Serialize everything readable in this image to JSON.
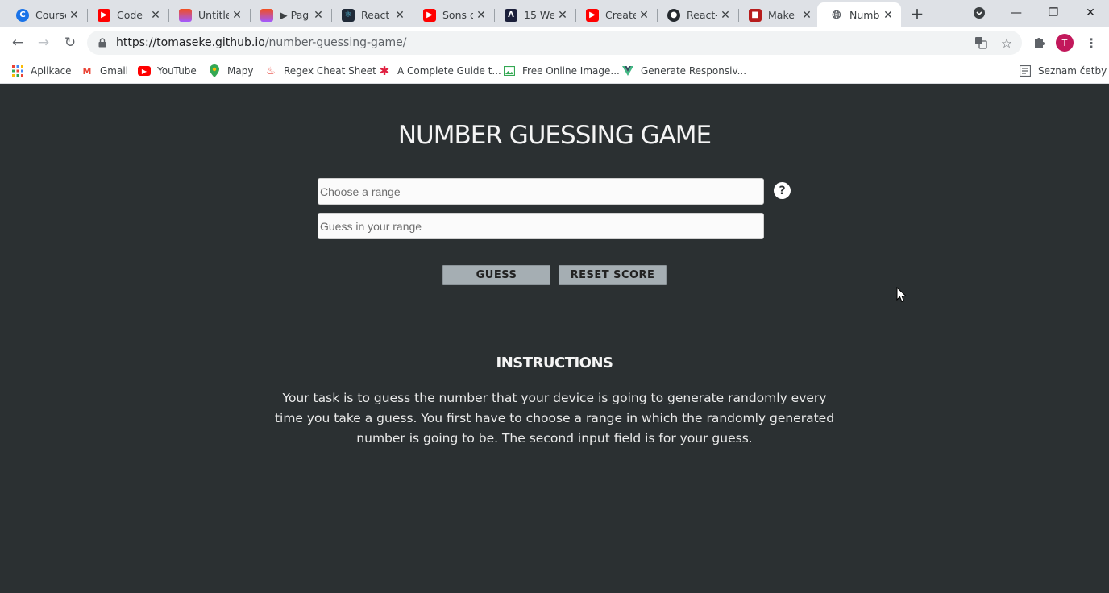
{
  "browser": {
    "tabs": [
      {
        "title": "Course",
        "favicon": "google-c-icon",
        "color": "#1a73e8"
      },
      {
        "title": "Code",
        "favicon": "youtube-icon",
        "color": "#ff0000"
      },
      {
        "title": "Untitle",
        "favicon": "figma-icon",
        "color": "#f24e1e"
      },
      {
        "title": "▶ Pag",
        "favicon": "figma-icon",
        "color": "#f24e1e"
      },
      {
        "title": "React",
        "favicon": "react-icon",
        "color": "#1f2937"
      },
      {
        "title": "Sons o",
        "favicon": "youtube-icon",
        "color": "#ff0000"
      },
      {
        "title": "15 We",
        "favicon": "dev-icon",
        "color": "#1b1f3a"
      },
      {
        "title": "Create",
        "favicon": "youtube-icon",
        "color": "#ff0000"
      },
      {
        "title": "React-",
        "favicon": "github-icon",
        "color": "#24292e"
      },
      {
        "title": "Make",
        "favicon": "ext-icon",
        "color": "#b71c1c"
      },
      {
        "title": "Numb",
        "favicon": "globe-icon",
        "color": "#5f6368"
      }
    ],
    "active_tab_index": 10,
    "url_host": "https://tomaseke.github.io",
    "url_path": "/number-guessing-game/",
    "avatar_letter": "T",
    "bookmarks": [
      {
        "label": "Aplikace",
        "icon": "apps-grid-icon"
      },
      {
        "label": "Gmail",
        "icon": "gmail-icon"
      },
      {
        "label": "YouTube",
        "icon": "youtube-icon"
      },
      {
        "label": "Mapy",
        "icon": "maps-pin-icon"
      },
      {
        "label": "Regex Cheat Sheet",
        "icon": "flame-icon"
      },
      {
        "label": "A Complete Guide t...",
        "icon": "asterisk-icon"
      },
      {
        "label": "Free Online Image...",
        "icon": "image-icon"
      },
      {
        "label": "Generate Responsiv...",
        "icon": "vue-icon"
      }
    ],
    "reading_list": "Seznam četby"
  },
  "game": {
    "title": "NUMBER GUESSING GAME",
    "range_placeholder": "Choose a range",
    "guess_placeholder": "Guess in your range",
    "help_label": "?",
    "guess_button": "GUESS",
    "reset_button": "RESET SCORE",
    "instructions_title": "INSTRUCTIONS",
    "instructions_text": "Your task is to guess the number that your device is going to generate randomly every time you take a guess. You first have to choose a range in which the randomly generated number is going to be. The second input field is for your guess."
  },
  "colors": {
    "page_background": "#2b3032",
    "button_background": "#a5aeb3",
    "avatar": "#c2185b"
  }
}
